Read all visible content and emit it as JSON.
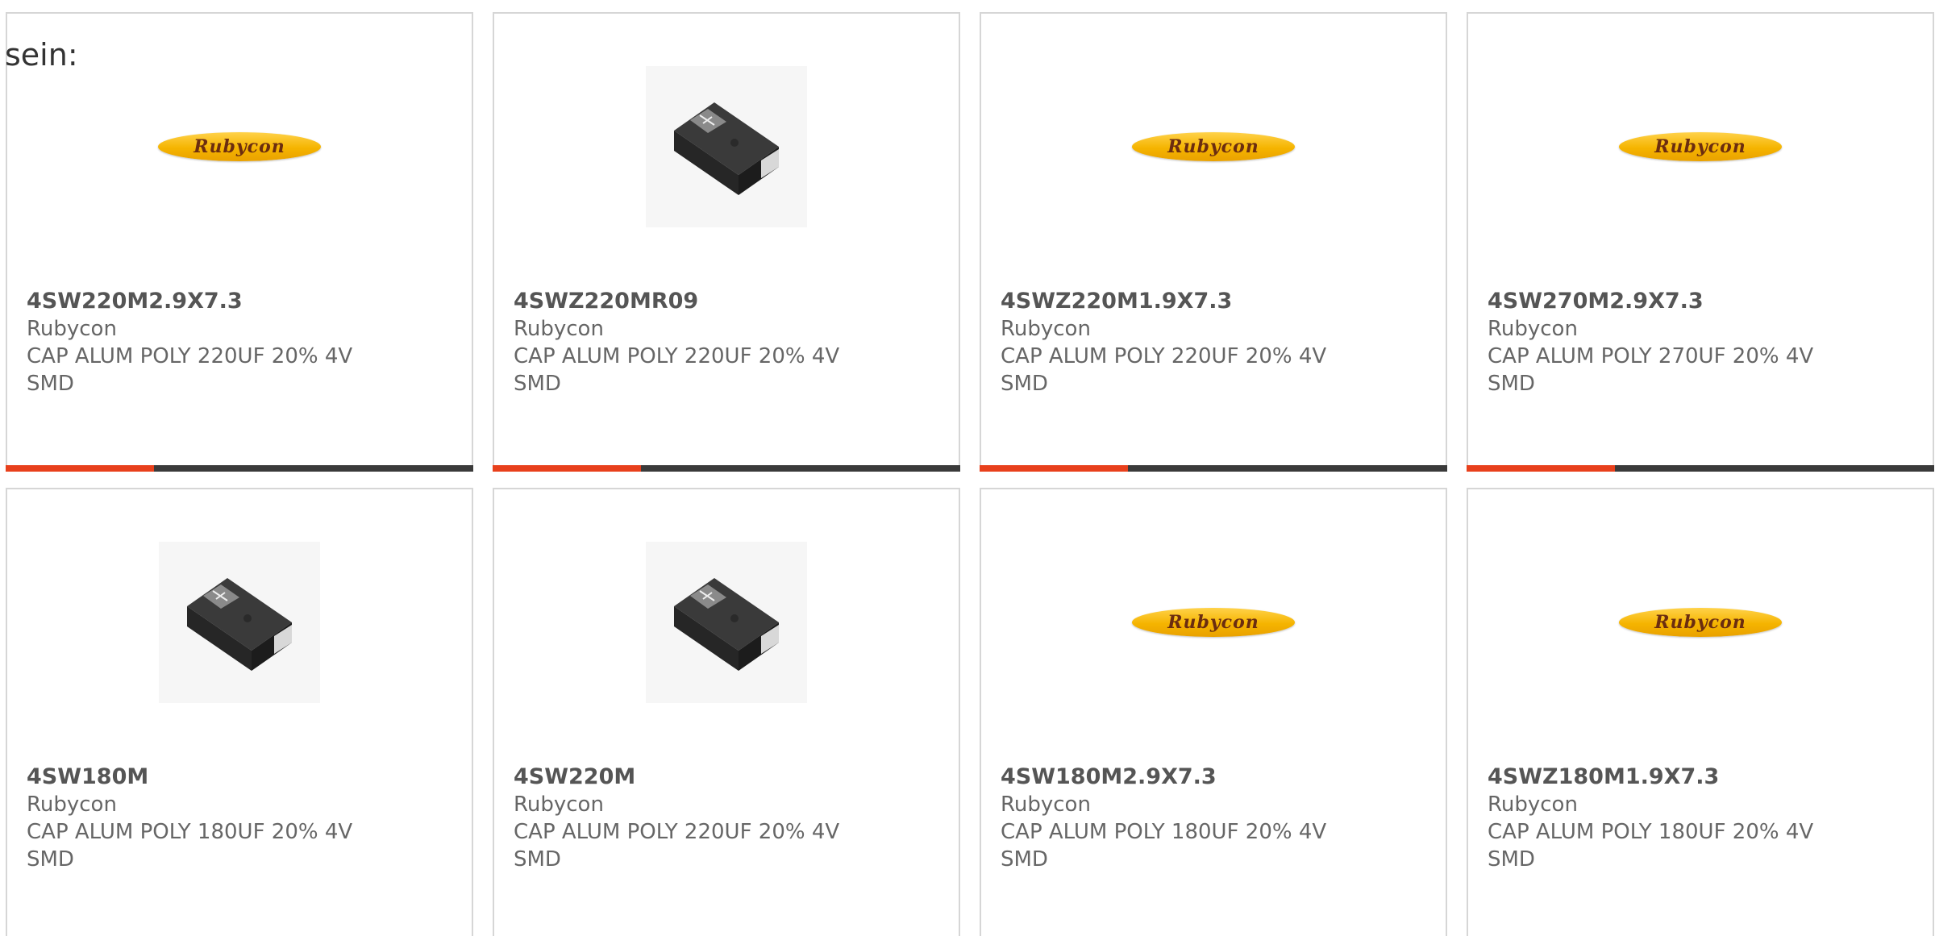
{
  "heading": "sein:",
  "products": [
    {
      "part": "4SW220M2.9X7.3",
      "brand": "Rubycon",
      "desc": "CAP ALUM POLY 220UF 20% 4V SMD",
      "image": "rubycon-logo",
      "logo_text": "Rubycon"
    },
    {
      "part": "4SWZ220MR09",
      "brand": "Rubycon",
      "desc": "CAP ALUM POLY 220UF 20% 4V SMD",
      "image": "smd-capacitor-photo",
      "logo_text": ""
    },
    {
      "part": "4SWZ220M1.9X7.3",
      "brand": "Rubycon",
      "desc": "CAP ALUM POLY 220UF 20% 4V SMD",
      "image": "rubycon-logo",
      "logo_text": "Rubycon"
    },
    {
      "part": "4SW270M2.9X7.3",
      "brand": "Rubycon",
      "desc": "CAP ALUM POLY 270UF 20% 4V SMD",
      "image": "rubycon-logo",
      "logo_text": "Rubycon"
    },
    {
      "part": "4SW180M",
      "brand": "Rubycon",
      "desc": "CAP ALUM POLY 180UF 20% 4V SMD",
      "image": "smd-capacitor-photo",
      "logo_text": ""
    },
    {
      "part": "4SW220M",
      "brand": "Rubycon",
      "desc": "CAP ALUM POLY 220UF 20% 4V SMD",
      "image": "smd-capacitor-photo",
      "logo_text": ""
    },
    {
      "part": "4SW180M2.9X7.3",
      "brand": "Rubycon",
      "desc": "CAP ALUM POLY 180UF 20% 4V SMD",
      "image": "rubycon-logo",
      "logo_text": "Rubycon"
    },
    {
      "part": "4SWZ180M1.9X7.3",
      "brand": "Rubycon",
      "desc": "CAP ALUM POLY 180UF 20% 4V SMD",
      "image": "rubycon-logo",
      "logo_text": "Rubycon"
    }
  ],
  "colors": {
    "accent": "#e8401c",
    "bar": "#3a3a3a",
    "logo_yellow": "#f5b400",
    "text": "#666666"
  }
}
